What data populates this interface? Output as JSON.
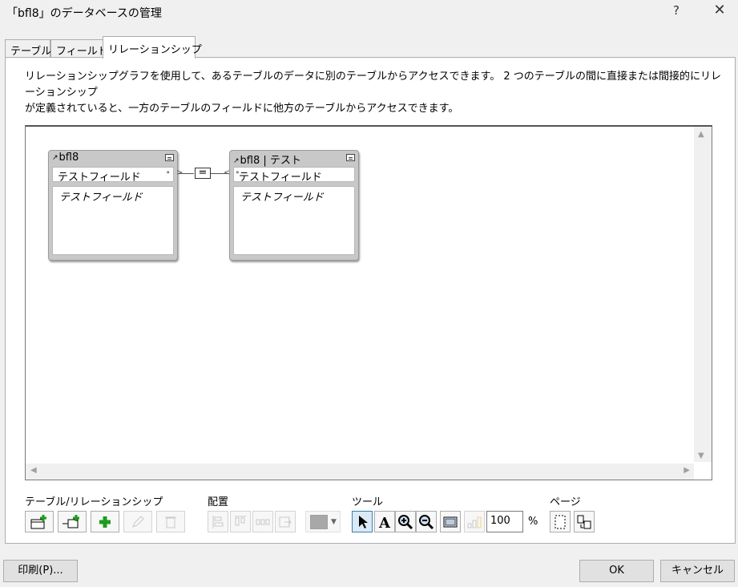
{
  "window": {
    "title": "「bfl8」のデータベースの管理",
    "help_label": "?",
    "close_label": "✕"
  },
  "tabs": [
    {
      "label": "テーブル"
    },
    {
      "label": "フィールド"
    },
    {
      "label": "リレーションシップ",
      "active": true
    }
  ],
  "description": {
    "line1": "リレーションシップグラフを使用して、あるテーブルのデータに別のテーブルからアクセスできます。 2 つのテーブルの間に直接または間接的にリレーションシップ",
    "line2": "が定義されていると、一方のテーブルのフィールドに他方のテーブルからアクセスできます。"
  },
  "graph": {
    "tables": [
      {
        "name": "bfl8",
        "key_field": "テストフィールド",
        "fields": [
          "テストフィールド"
        ]
      },
      {
        "name": "bfl8 | テスト",
        "key_field": "テストフィールド",
        "fields": [
          "テストフィールド"
        ]
      }
    ],
    "relationship_operator": "=",
    "scroll": {
      "up": "▲",
      "down": "▼",
      "left": "◀",
      "right": "▶"
    }
  },
  "toolbar": {
    "groups": {
      "tables_relationships": "テーブル/リレーションシップ",
      "arrange": "配置",
      "tools": "ツール",
      "page": "ページ"
    },
    "icons": [
      "add-table-icon",
      "add-relationship-icon",
      "duplicate-icon",
      "edit-pencil-icon",
      "delete-trash-icon",
      "align-left-icon",
      "align-top-icon",
      "distribute-horizontal-icon",
      "resize-icon",
      "pointer-icon",
      "text-tool-icon",
      "zoom-in-icon",
      "zoom-out-icon",
      "fit-window-icon",
      "toggle-display-icon",
      "show-page-breaks-icon",
      "page-setup-icon"
    ],
    "zoom_value": "100",
    "zoom_unit": "%",
    "color_swatch": "#a8a8a8",
    "dropdown_arrow": "▼"
  },
  "buttons": {
    "print": "印刷(P)...",
    "ok": "OK",
    "cancel": "キャンセル"
  }
}
